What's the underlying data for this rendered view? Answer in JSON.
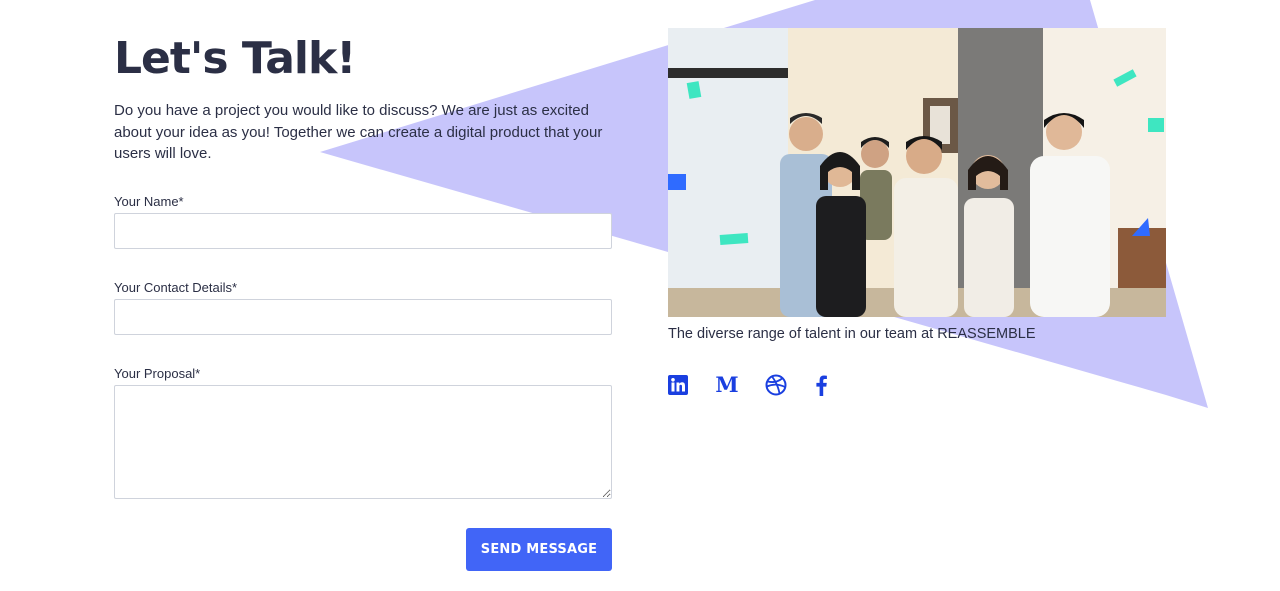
{
  "header": {
    "title": "Let's Talk!",
    "intro": "Do you have a project you would like to discuss? We are just as excited about your idea as you! Together we can create a digital product that your users will love."
  },
  "form": {
    "name_label": "Your Name*",
    "name_value": "",
    "contact_label": "Your Contact Details*",
    "contact_value": "",
    "proposal_label": "Your Proposal*",
    "proposal_value": "",
    "submit_label": "SEND MESSAGE"
  },
  "photo": {
    "caption": "The diverse range of talent in our team at REASSEMBLE"
  },
  "social": [
    {
      "icon": "linkedin-icon"
    },
    {
      "icon": "medium-icon",
      "glyph": "M"
    },
    {
      "icon": "dribbble-icon"
    },
    {
      "icon": "facebook-icon"
    }
  ],
  "colors": {
    "accent": "#4165f7",
    "background_shape": "#c7c5fb",
    "icon": "#1a3fe0",
    "text": "#2b2f45",
    "confetti": "#3ee6c1"
  }
}
